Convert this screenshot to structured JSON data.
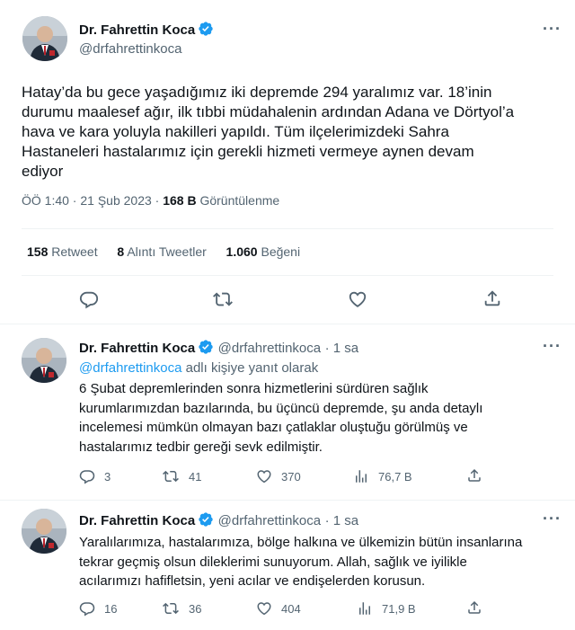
{
  "main_tweet": {
    "author_name": "Dr. Fahrettin Koca",
    "author_handle": "@drfahrettinkoca",
    "more_label": "···",
    "text_lines": [
      "Hatay’da bu gece yaşadığımız iki depremde 294 yaralımız var. 18’inin",
      "durumu maalesef ağır, ilk tıbbi müdahalenin ardından Adana ve Dörtyol’a",
      "hava ve kara yoluyla nakilleri yapıldı. Tüm ilçelerimizdeki Sahra",
      "Hastaneleri hastalarımız için gerekli hizmeti vermeye aynen devam",
      "ediyor"
    ],
    "time": "ÖÖ 1:40 · 21 Şub 2023 ·",
    "views_count": "168 B",
    "views_label": "Görüntülenme",
    "retweets_count": "158",
    "retweets_label": "Retweet",
    "quotes_count": "8",
    "quotes_label": "Alıntı Tweetler",
    "likes_count": "1.060",
    "likes_label": "Beğeni"
  },
  "replies": [
    {
      "author_name": "Dr. Fahrettin Koca",
      "author_handle": "@drfahrettinkoca",
      "time": "· 1 sa",
      "more_label": "···",
      "reply_to_mention": "@drfahrettinkoca",
      "reply_to_suffix": "adlı kişiye yanıt olarak",
      "text_lines": [
        "6 Şubat depremlerinden sonra hizmetlerini sürdüren sağlık",
        "kurumlarımızdan bazılarında, bu üçüncü depremde, şu anda detaylı",
        "incelemesi mümkün olmayan bazı çatlaklar oluştuğu görülmüş ve",
        "hastalarımız tedbir gereği sevk edilmiştir."
      ],
      "reply_count": "3",
      "retweet_count": "41",
      "like_count": "370",
      "view_count": "76,7 B"
    },
    {
      "author_name": "Dr. Fahrettin Koca",
      "author_handle": "@drfahrettinkoca",
      "time": "· 1 sa",
      "more_label": "···",
      "text_lines": [
        "Yaralılarımıza, hastalarımıza, bölge halkına ve ülkemizin bütün insanlarına",
        "tekrar geçmiş olsun dileklerimi sunuyorum. Allah, sağlık ve iyilikle",
        "acılarımızı hafifletsin, yeni acılar ve endişelerden korusun."
      ],
      "reply_count": "16",
      "retweet_count": "36",
      "like_count": "404",
      "view_count": "71,9 B"
    }
  ],
  "colors": {
    "text": "#0f1419",
    "secondary": "#536471",
    "accent": "#1d9bf0",
    "divider": "#eff3f4",
    "verified": "#1d9bf0"
  }
}
